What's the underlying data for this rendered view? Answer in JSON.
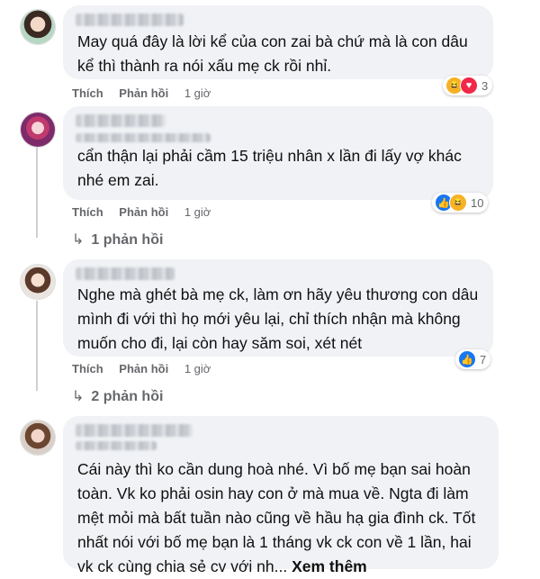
{
  "labels": {
    "like": "Thích",
    "reply": "Phản hồi"
  },
  "comments": [
    {
      "text": "May quá đây là lời kể của con zai bà chứ mà là con dâu\nkể thì thành ra nói xấu mẹ ck rồi nhỉ.",
      "time": "1 giờ",
      "reactions": [
        "haha",
        "love"
      ],
      "reaction_count": "3",
      "replies": ""
    },
    {
      "text": "cẩn thận lại phải cầm 15 triệu nhân x lần đi lấy vợ khác\nnhé em zai.",
      "time": "1 giờ",
      "reactions": [
        "like",
        "haha"
      ],
      "reaction_count": "10",
      "replies": "1 phản hồi"
    },
    {
      "text": "Nghe mà ghét bà mẹ ck, làm ơn hãy yêu thương con dâu\nmình đi với thì họ mới yêu lại, chỉ thích nhận mà không\nmuốn cho đi, lại còn hay săm soi, xét nét",
      "time": "1 giờ",
      "reactions": [
        "like"
      ],
      "reaction_count": "7",
      "replies": "2 phản hồi"
    },
    {
      "text": "Cái này thì ko cần dung hoà nhé. Vì bố mẹ bạn sai hoàn\ntoàn. Vk ko phải osin hay con ở mà mua về. Ngta đi làm\nmệt mỏi mà bất tuần nào cũng về hầu hạ gia đình ck. Tốt\nnhất nói với bố mẹ bạn là 1 tháng vk ck con về 1 lần, hai\nvk ck cùng chia sẻ cv với nh...",
      "see_more": "Xem thêm",
      "time": "",
      "reactions": [],
      "reaction_count": "",
      "replies": ""
    }
  ],
  "colors": {
    "bubble": "#f0f2f5",
    "meta": "#65676b",
    "like": "#1877f2",
    "love": "#f02849",
    "haha": "#f7b125"
  }
}
